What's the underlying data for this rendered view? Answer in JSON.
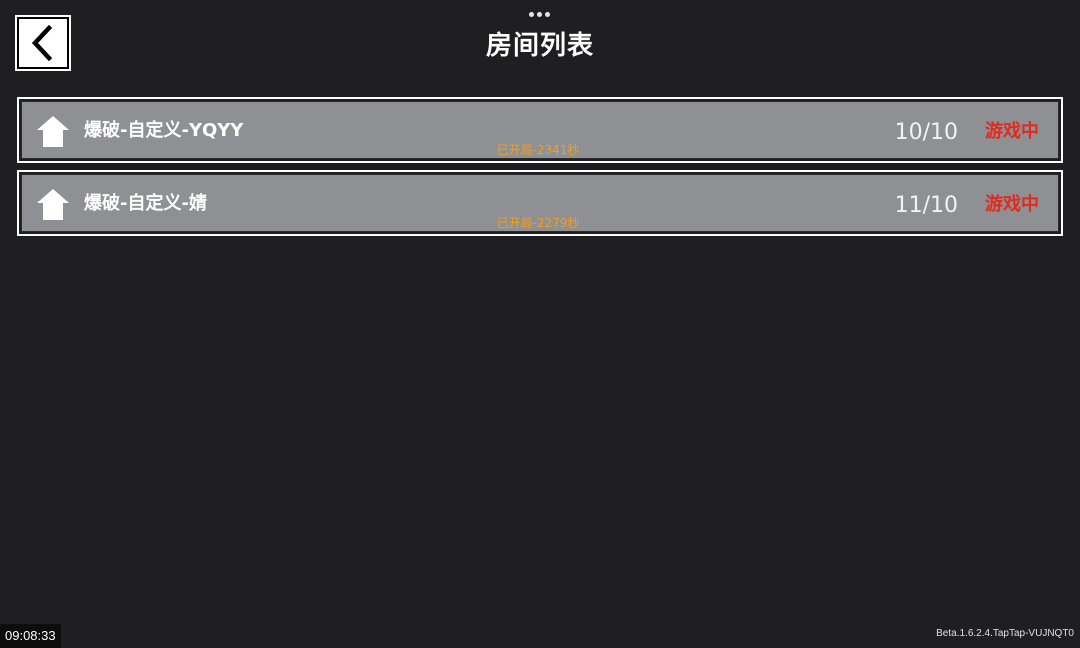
{
  "header": {
    "title": "房间列表",
    "back_icon": "chevron-left-icon",
    "menu_icon": "more-dots-icon"
  },
  "rooms": [
    {
      "icon": "house-icon",
      "name": "爆破-自定义-YQYY",
      "elapsed": "已开局-2341秒",
      "players": "10/10",
      "status": "游戏中"
    },
    {
      "icon": "house-icon",
      "name": "爆破-自定义-婧",
      "elapsed": "已开局-2279秒",
      "players": "11/10",
      "status": "游戏中"
    }
  ],
  "footer": {
    "clock": "09:08:33",
    "version": "Beta.1.6.2.4.TapTap-VUJNQT0"
  },
  "colors": {
    "background": "#1f1f22",
    "room_card": "#8f9094",
    "elapsed_text": "#f0a020",
    "status_text": "#e02a1e"
  }
}
